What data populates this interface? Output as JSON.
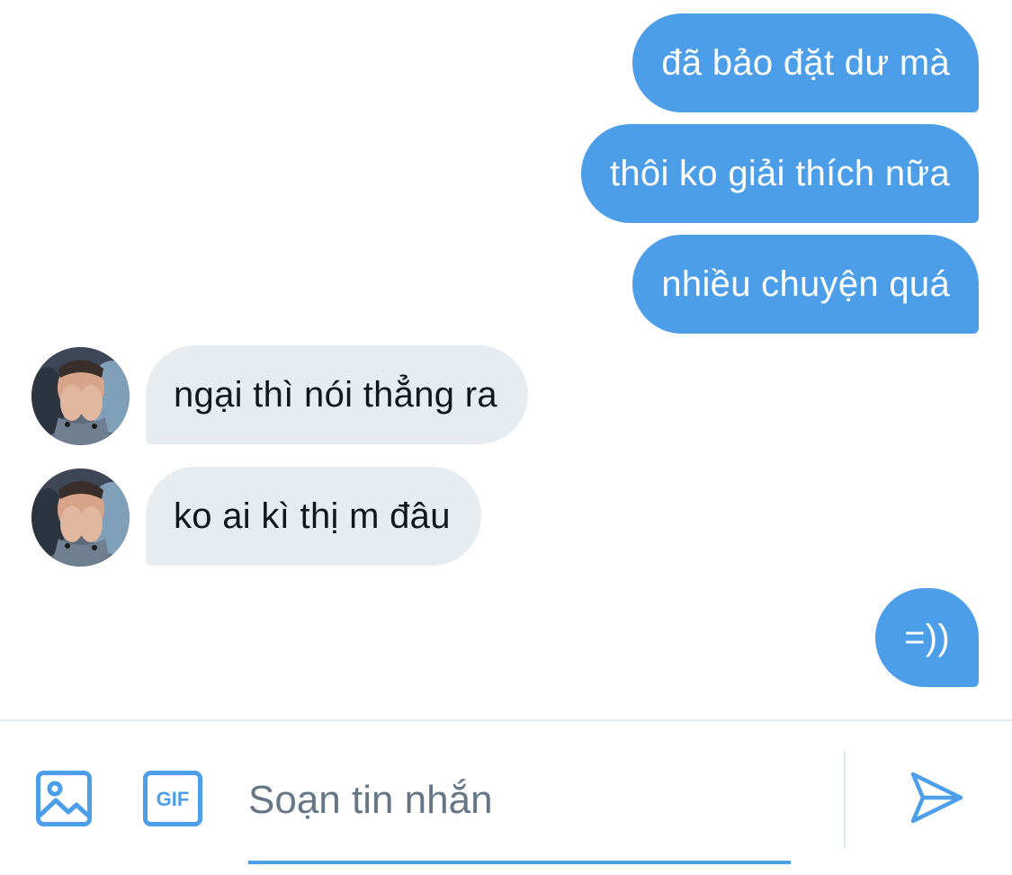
{
  "conversation": {
    "messages": [
      {
        "direction": "outgoing",
        "text": "đã bảo đặt dư mà"
      },
      {
        "direction": "outgoing",
        "text": "thôi ko giải thích nữa"
      },
      {
        "direction": "outgoing",
        "text": "nhiều chuyện quá"
      },
      {
        "direction": "incoming",
        "text": "ngại thì nói thẳng ra"
      },
      {
        "direction": "incoming",
        "text": "ko ai kì thị m đâu"
      },
      {
        "direction": "outgoing",
        "text": "=))"
      }
    ]
  },
  "composer": {
    "placeholder": "Soạn tin nhắn",
    "value": "",
    "gif_label": "GIF",
    "icons": [
      "image-icon",
      "gif-icon",
      "send-icon"
    ]
  },
  "colors": {
    "outgoing_bubble": "#4c9ee8",
    "incoming_bubble": "#e6ecf0",
    "accent": "#4c9ee8",
    "placeholder": "#657786",
    "divider": "#e1e8ed"
  }
}
